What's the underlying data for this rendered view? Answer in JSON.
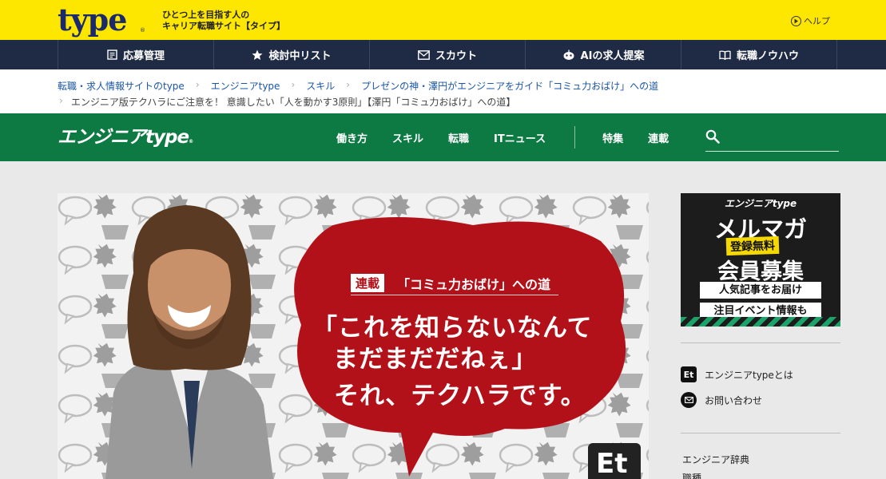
{
  "header": {
    "logo": "type",
    "logo_mark": "®",
    "tagline_line1": "ひとつ上を目指す人の",
    "tagline_line2": "キャリア転職サイト【タイプ】",
    "help_label": "ヘルプ"
  },
  "main_nav": [
    {
      "label": "応募管理",
      "icon": "document-icon"
    },
    {
      "label": "検討中リスト",
      "icon": "star-icon"
    },
    {
      "label": "スカウト",
      "icon": "mail-icon"
    },
    {
      "label": "AIの求人提案",
      "icon": "ai-icon"
    },
    {
      "label": "転職ノウハウ",
      "icon": "book-icon"
    }
  ],
  "breadcrumb": {
    "items": [
      "転職・求人情報サイトのtype",
      "エンジニアtype",
      "スキル",
      "プレゼンの神・澤円がエンジニアをガイド「コミュ力おばけ」への道"
    ],
    "current": "エンジニア版テクハラにご注意を！ 意識したい「人を動かす3原則」【澤円「コミュ力おばけ」への道】"
  },
  "site_nav": {
    "logo": "エンジニアtype",
    "logo_mark": "®",
    "items": [
      "働き方",
      "スキル",
      "転職",
      "ITニュース"
    ],
    "items_right": [
      "特集",
      "連載"
    ],
    "search_placeholder": ""
  },
  "hero": {
    "tag": "連載",
    "series": "「コミュ力おばけ」への道",
    "headline_line1": "「これを知らないなんて",
    "headline_line2": "まだまだだねぇ」",
    "headline_line3": "それ、テクハラです。",
    "badge": "Et",
    "bubble_color": "#b3111a"
  },
  "sidebar": {
    "ad": {
      "brand": "エンジニアtype",
      "main": "メルマガ",
      "free": "登録無料",
      "member": "会員募集",
      "box1": "人気記事をお届け",
      "box2": "注目イベント情報も"
    },
    "links": [
      {
        "label": "エンジニアtypeとは",
        "icon": "et-icon",
        "icon_text": "Et"
      },
      {
        "label": "お問い合わせ",
        "icon": "mail-icon"
      }
    ],
    "section_title": "エンジニア辞典",
    "section_item": "職種"
  }
}
